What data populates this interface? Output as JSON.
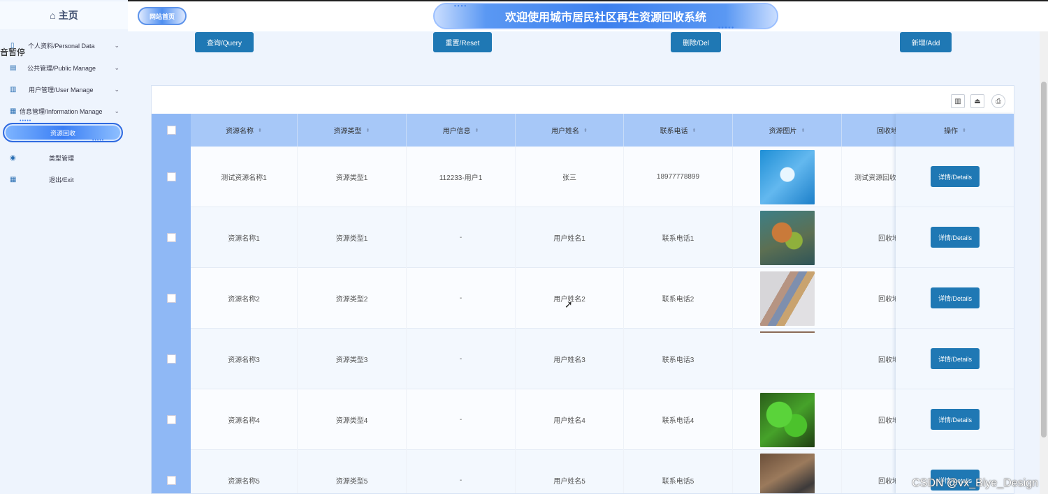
{
  "sidebar": {
    "home": "主页",
    "overflow_text": "音暂停",
    "items": [
      {
        "label": "个人资料/Personal Data",
        "icon": "document-icon",
        "expandable": true
      },
      {
        "label": "公共管理/Public Manage",
        "icon": "clipboard-icon",
        "expandable": true
      },
      {
        "label": "用户管理/User Manage",
        "icon": "user-chart-icon",
        "expandable": true
      },
      {
        "label": "信息管理/Information Manage",
        "icon": "bar-chart-icon",
        "expandable": true
      },
      {
        "label": "资源回收",
        "active": true
      },
      {
        "label": "类型管理",
        "icon": "badge-icon"
      },
      {
        "label": "退出/Exit",
        "icon": "calendar-icon"
      }
    ]
  },
  "header": {
    "site_home": "网站首页",
    "title": "欢迎使用城市居民社区再生资源回收系统"
  },
  "actions": {
    "query": "查询/Query",
    "reset": "重置/Reset",
    "delete": "删除/Del",
    "add": "新增/Add"
  },
  "table": {
    "columns": [
      "资源名称",
      "资源类型",
      "用户信息",
      "用户姓名",
      "联系电话",
      "资源图片",
      "回收地"
    ],
    "op_column": "操作",
    "details_label": "详情/Details",
    "rows": [
      {
        "name": "测试资源名称1",
        "type": "资源类型1",
        "user_info": "112233-用户1",
        "user_name": "张三",
        "phone": "18977778899",
        "image": "tech",
        "address": "测试资源回收"
      },
      {
        "name": "资源名称1",
        "type": "资源类型1",
        "user_info": "-",
        "user_name": "用户姓名1",
        "phone": "联系电话1",
        "image": "bin",
        "address": "回收地"
      },
      {
        "name": "资源名称2",
        "type": "资源类型2",
        "user_info": "-",
        "user_name": "用户姓名2",
        "phone": "联系电话2",
        "image": "cards",
        "address": "回收地"
      },
      {
        "name": "资源名称3",
        "type": "资源类型3",
        "user_info": "-",
        "user_name": "用户姓名3",
        "phone": "联系电话3",
        "image": "line",
        "address": "回收地"
      },
      {
        "name": "资源名称4",
        "type": "资源类型4",
        "user_info": "-",
        "user_name": "用户姓名4",
        "phone": "联系电话4",
        "image": "leaf",
        "address": "回收地"
      },
      {
        "name": "资源名称5",
        "type": "资源类型5",
        "user_info": "-",
        "user_name": "用户姓名5",
        "phone": "联系电话5",
        "image": "box",
        "address": "回收地"
      }
    ]
  },
  "watermark": "CSDN @vx_Biye_Design",
  "colors": {
    "primary_button": "#1f78b4",
    "table_header": "#a7c8f8",
    "accent": "#3b7ff5"
  }
}
